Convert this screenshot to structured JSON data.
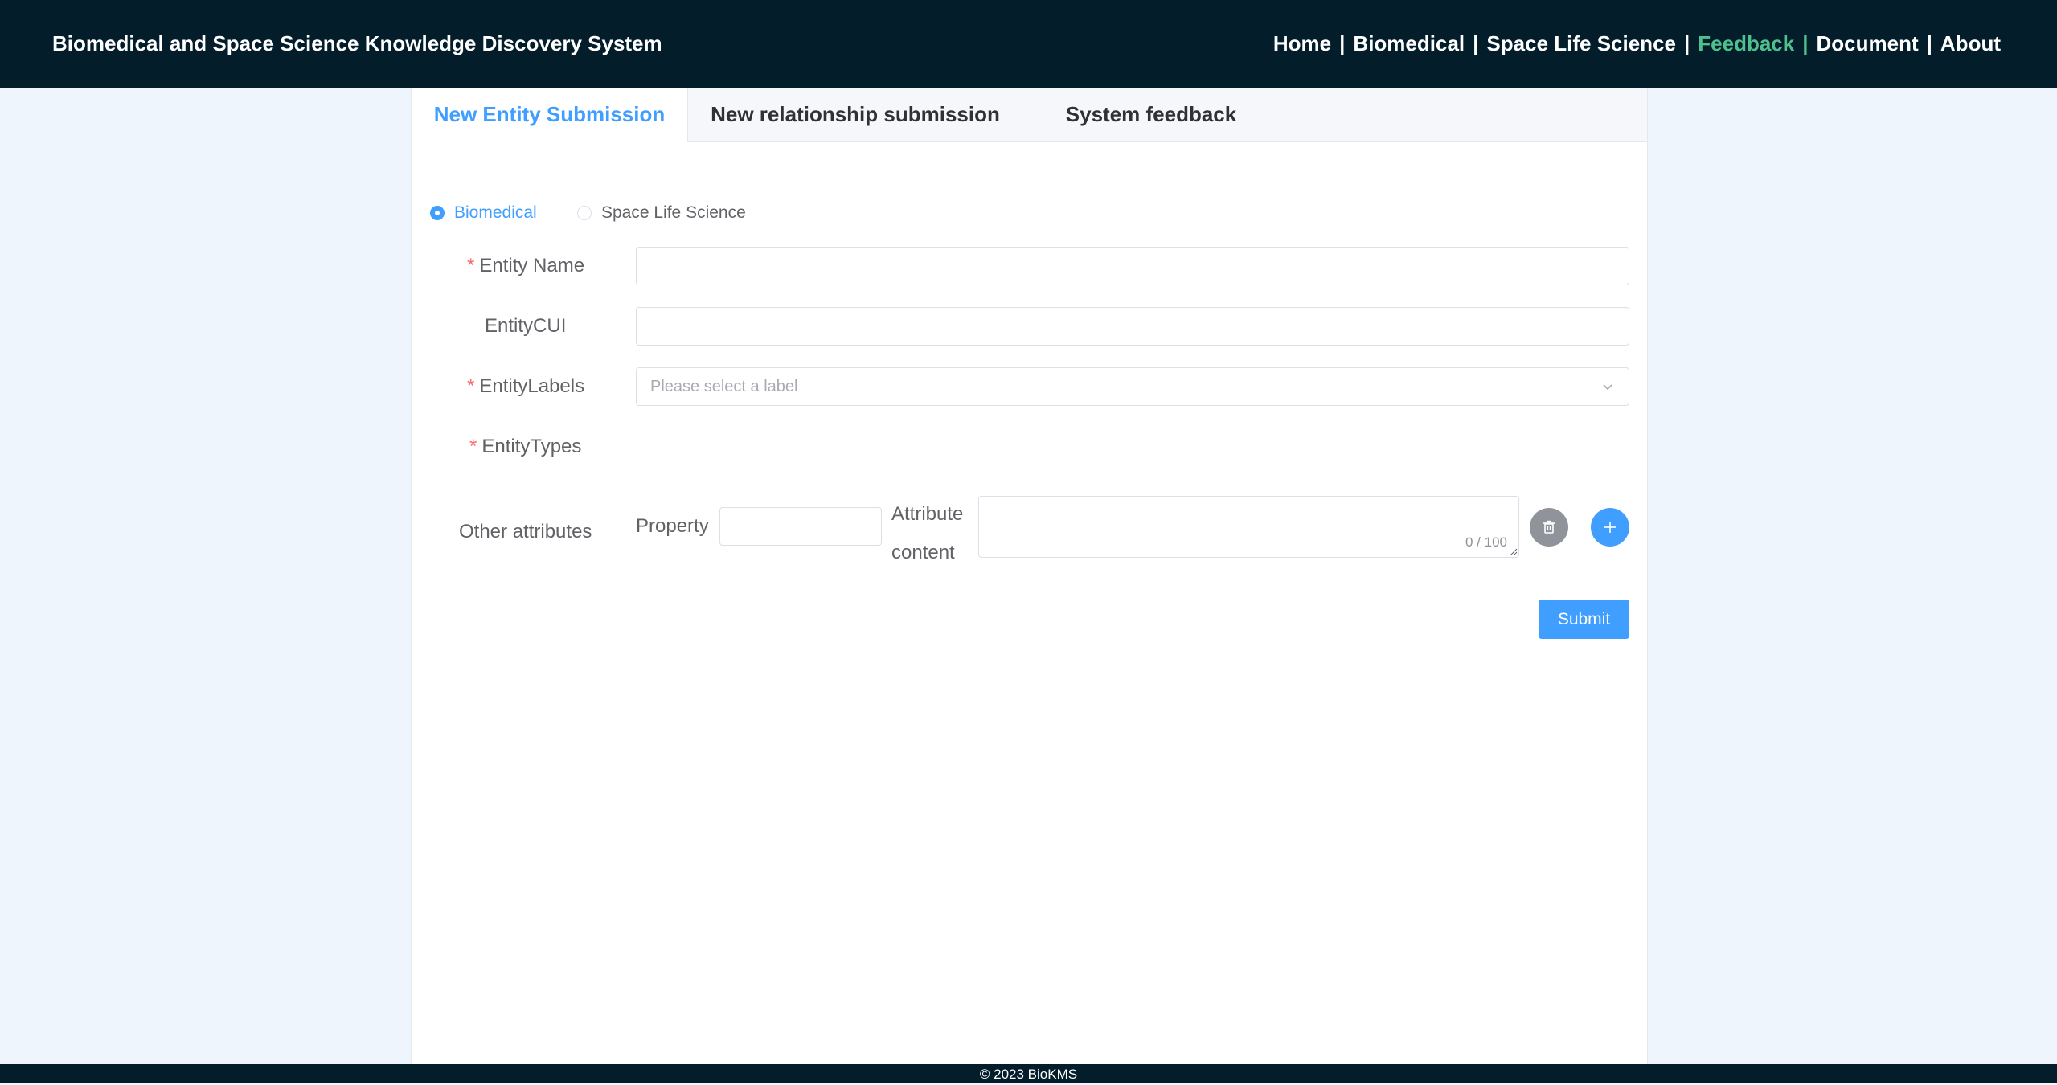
{
  "header": {
    "app_title": "Biomedical and Space Science Knowledge Discovery System",
    "nav": {
      "home": "Home",
      "biomedical": "Biomedical",
      "space_life_science": "Space Life Science",
      "feedback": "Feedback",
      "document": "Document",
      "about": "About",
      "separator": "|",
      "active_item": "Feedback",
      "active_color": "#4fc08d"
    },
    "background_color": "#031d2b"
  },
  "tabs": {
    "entity": "New Entity Submission",
    "relationship": "New relationship submission",
    "feedback": "System feedback",
    "active_tab": "New Entity Submission"
  },
  "domain_radio": {
    "biomedical": "Biomedical",
    "space_life_science": "Space Life Science",
    "selected": "Biomedical"
  },
  "form": {
    "required_mark": "*",
    "entity_name_label": "Entity Name",
    "entity_name_value": "",
    "entity_cui_label": "EntityCUI",
    "entity_cui_value": "",
    "entity_labels_label": "EntityLabels",
    "entity_labels_placeholder": "Please select a label",
    "entity_types_label": "EntityTypes",
    "other_attributes_label": "Other attributes",
    "property_label": "Property",
    "property_value": "",
    "attribute_content_label_line1": "Attribute",
    "attribute_content_label_line2": "content",
    "attribute_content_value": "",
    "attribute_content_counter": "0 / 100",
    "submit_label": "Submit",
    "accent_color": "#409eff",
    "required_color": "#f56c6c"
  },
  "icons": {
    "delete_attribute": "trash-icon",
    "add_attribute": "plus-icon",
    "select_dropdown": "chevron-down-icon"
  },
  "footer": {
    "copyright": "© 2023 BioKMS"
  }
}
